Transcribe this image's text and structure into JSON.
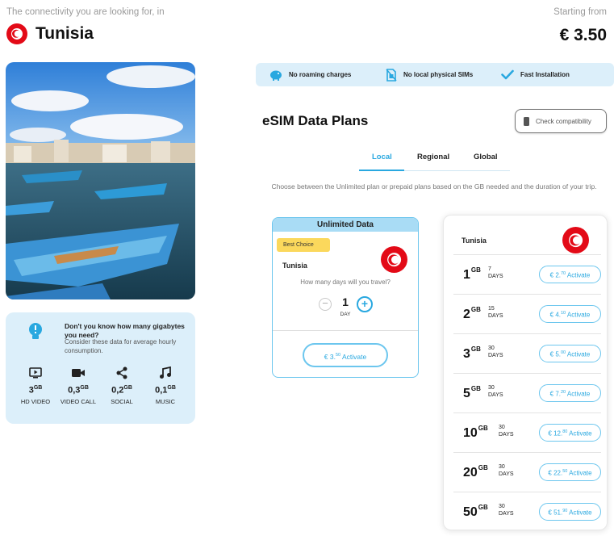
{
  "header": {
    "subtitle": "The connectivity you are looking for, in",
    "country": "Tunisia",
    "starting_label": "Starting from",
    "starting_price": "€ 3.50"
  },
  "gb_info": {
    "title": "Don't you know how many gigabytes you need?",
    "description": "Consider these data for average hourly consumption.",
    "usage": [
      {
        "value": "3",
        "unit": "GB",
        "label": "HD VIDEO",
        "icon": "video-play-icon"
      },
      {
        "value": "0,3",
        "unit": "GB",
        "label": "VIDEO CALL",
        "icon": "video-camera-icon"
      },
      {
        "value": "0,2",
        "unit": "GB",
        "label": "SOCIAL",
        "icon": "share-icon"
      },
      {
        "value": "0,1",
        "unit": "GB",
        "label": "MUSIC",
        "icon": "music-note-icon"
      }
    ]
  },
  "features": [
    {
      "label": "No roaming charges",
      "icon": "piggy-bank-icon"
    },
    {
      "label": "No local physical SIMs",
      "icon": "no-sim-icon"
    },
    {
      "label": "Fast Installation",
      "icon": "checkmark-icon"
    }
  ],
  "plans": {
    "title": "eSIM Data Plans",
    "compat_label": "Check compatibility",
    "tabs": [
      "Local",
      "Regional",
      "Global"
    ],
    "active_tab": "Local",
    "intro": "Choose between the Unlimited plan or prepaid plans based on the GB needed and the duration of your trip."
  },
  "unlimited": {
    "header": "Unlimited Data",
    "badge": "Best Choice",
    "country": "Tunisia",
    "question": "How many days will you travel?",
    "days": "1",
    "days_label": "DAY",
    "price_main": "€ 3.",
    "price_cents": "50",
    "action": "Activate"
  },
  "prepaid": {
    "country": "Tunisia",
    "unit": "GB",
    "days_label": "DAYS",
    "action": "Activate",
    "rows": [
      {
        "gb": "1",
        "days": "7",
        "price_main": "€ 2.",
        "price_cents": "70"
      },
      {
        "gb": "2",
        "days": "15",
        "price_main": "€ 4.",
        "price_cents": "10"
      },
      {
        "gb": "3",
        "days": "30",
        "price_main": "€ 5.",
        "price_cents": "00"
      },
      {
        "gb": "5",
        "days": "30",
        "price_main": "€ 7.",
        "price_cents": "20"
      },
      {
        "gb": "10",
        "days": "30",
        "price_main": "€ 12.",
        "price_cents": "80"
      },
      {
        "gb": "20",
        "days": "30",
        "price_main": "€ 22.",
        "price_cents": "50"
      },
      {
        "gb": "50",
        "days": "30",
        "price_main": "€ 51.",
        "price_cents": "90"
      }
    ]
  },
  "colors": {
    "accent": "#29a8e0",
    "panel": "#dceffa",
    "flag_red": "#e30a17",
    "badge": "#fbd85c"
  }
}
